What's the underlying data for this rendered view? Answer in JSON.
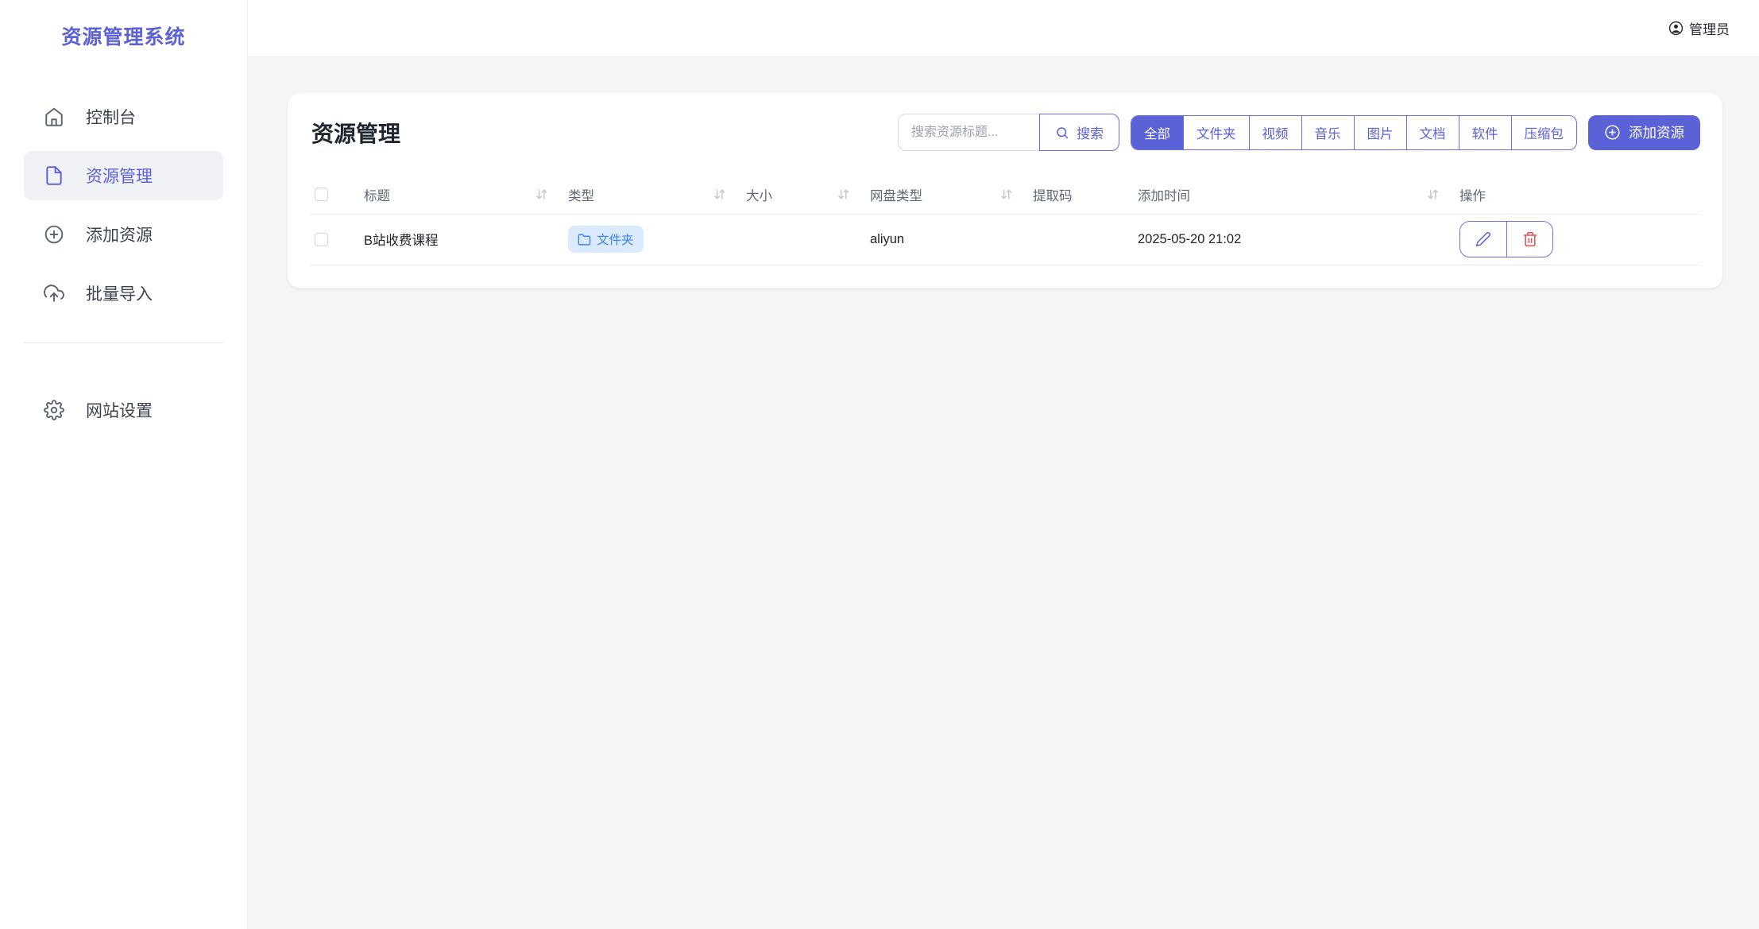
{
  "colors": {
    "primary": "#5b61d6",
    "primary_border": "#6a6ee0",
    "badge_bg": "#dbeafe",
    "badge_text": "#3b82f6",
    "danger": "#e05656"
  },
  "app": {
    "logo_title": "资源管理系统",
    "user_name": "管理员"
  },
  "sidebar": {
    "items": [
      {
        "icon": "home-icon",
        "label": "控制台",
        "active": false
      },
      {
        "icon": "file-icon",
        "label": "资源管理",
        "active": true
      },
      {
        "icon": "plus-circle-icon",
        "label": "添加资源",
        "active": false
      },
      {
        "icon": "upload-cloud-icon",
        "label": "批量导入",
        "active": false
      }
    ],
    "footer_items": [
      {
        "icon": "gear-icon",
        "label": "网站设置",
        "active": false
      }
    ]
  },
  "page": {
    "title": "资源管理",
    "search": {
      "placeholder": "搜索资源标题...",
      "button_label": "搜索"
    },
    "filter_tabs": [
      {
        "label": "全部",
        "active": true
      },
      {
        "label": "文件夹",
        "active": false
      },
      {
        "label": "视频",
        "active": false
      },
      {
        "label": "音乐",
        "active": false
      },
      {
        "label": "图片",
        "active": false
      },
      {
        "label": "文档",
        "active": false
      },
      {
        "label": "软件",
        "active": false
      },
      {
        "label": "压缩包",
        "active": false
      }
    ],
    "add_button_label": "添加资源",
    "table": {
      "columns": [
        {
          "key": "checkbox",
          "label": "",
          "sortable": false
        },
        {
          "key": "title",
          "label": "标题",
          "sortable": true
        },
        {
          "key": "type",
          "label": "类型",
          "sortable": true
        },
        {
          "key": "size",
          "label": "大小",
          "sortable": true
        },
        {
          "key": "disk",
          "label": "网盘类型",
          "sortable": true
        },
        {
          "key": "code",
          "label": "提取码",
          "sortable": false
        },
        {
          "key": "added",
          "label": "添加时间",
          "sortable": true
        },
        {
          "key": "actions",
          "label": "操作",
          "sortable": false
        }
      ],
      "select_all_checked": false,
      "rows": [
        {
          "checked": false,
          "title": "B站收费课程",
          "type_label": "文件夹",
          "type_icon": "folder-icon",
          "size": "",
          "disk": "aliyun",
          "code": "",
          "added": "2025-05-20 21:02"
        }
      ]
    }
  }
}
